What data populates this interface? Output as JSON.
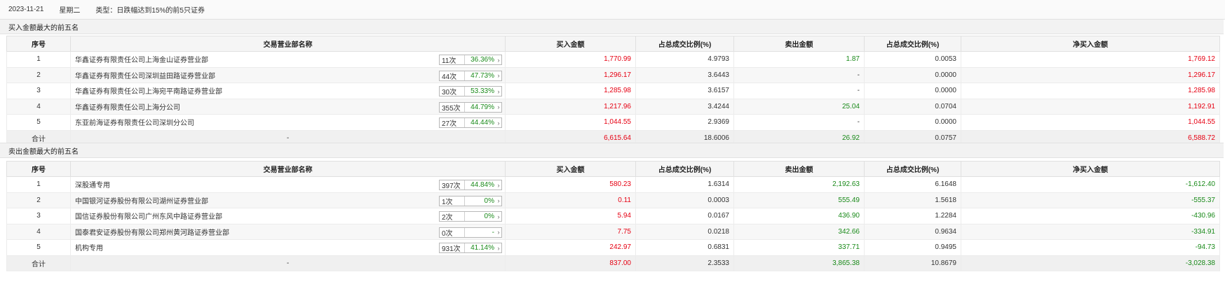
{
  "header": {
    "date": "2023-11-21",
    "weekday": "星期二",
    "type_label": "类型：",
    "type_value": "日跌幅达到15%的前5只证券"
  },
  "columns": [
    "序号",
    "交易营业部名称",
    "买入金额",
    "占总成交比例(%)",
    "卖出金额",
    "占总成交比例(%)",
    "净买入金额"
  ],
  "buy_section": {
    "title": "买入金额最大的前五名",
    "rows": [
      {
        "idx": "1",
        "name": "华鑫证券有限责任公司上海金山证券营业部",
        "count": "11次",
        "rate": "36.36%",
        "buy": "1,770.99",
        "buy_pct": "4.9793",
        "sell": "1.87",
        "sell_pct": "0.0053",
        "net": "1,769.12"
      },
      {
        "idx": "2",
        "name": "华鑫证券有限责任公司深圳益田路证券营业部",
        "count": "44次",
        "rate": "47.73%",
        "buy": "1,296.17",
        "buy_pct": "3.6443",
        "sell": "-",
        "sell_pct": "0.0000",
        "net": "1,296.17"
      },
      {
        "idx": "3",
        "name": "华鑫证券有限责任公司上海宛平南路证券营业部",
        "count": "30次",
        "rate": "53.33%",
        "buy": "1,285.98",
        "buy_pct": "3.6157",
        "sell": "-",
        "sell_pct": "0.0000",
        "net": "1,285.98"
      },
      {
        "idx": "4",
        "name": "华鑫证券有限责任公司上海分公司",
        "count": "355次",
        "rate": "44.79%",
        "buy": "1,217.96",
        "buy_pct": "3.4244",
        "sell": "25.04",
        "sell_pct": "0.0704",
        "net": "1,192.91"
      },
      {
        "idx": "5",
        "name": "东亚前海证券有限责任公司深圳分公司",
        "count": "27次",
        "rate": "44.44%",
        "buy": "1,044.55",
        "buy_pct": "2.9369",
        "sell": "-",
        "sell_pct": "0.0000",
        "net": "1,044.55"
      }
    ],
    "total": {
      "label": "合计",
      "name": "-",
      "buy": "6,615.64",
      "buy_pct": "18.6006",
      "sell": "26.92",
      "sell_pct": "0.0757",
      "net": "6,588.72"
    }
  },
  "sell_section": {
    "title": "卖出金额最大的前五名",
    "rows": [
      {
        "idx": "1",
        "name": "深股通专用",
        "count": "397次",
        "rate": "44.84%",
        "buy": "580.23",
        "buy_pct": "1.6314",
        "sell": "2,192.63",
        "sell_pct": "6.1648",
        "net": "-1,612.40"
      },
      {
        "idx": "2",
        "name": "中国银河证券股份有限公司湖州证券营业部",
        "count": "1次",
        "rate": "0%",
        "buy": "0.11",
        "buy_pct": "0.0003",
        "sell": "555.49",
        "sell_pct": "1.5618",
        "net": "-555.37"
      },
      {
        "idx": "3",
        "name": "国信证券股份有限公司广州东风中路证券营业部",
        "count": "2次",
        "rate": "0%",
        "buy": "5.94",
        "buy_pct": "0.0167",
        "sell": "436.90",
        "sell_pct": "1.2284",
        "net": "-430.96"
      },
      {
        "idx": "4",
        "name": "国泰君安证券股份有限公司郑州黄河路证券营业部",
        "count": "0次",
        "rate": "-",
        "buy": "7.75",
        "buy_pct": "0.0218",
        "sell": "342.66",
        "sell_pct": "0.9634",
        "net": "-334.91"
      },
      {
        "idx": "5",
        "name": "机构专用",
        "count": "931次",
        "rate": "41.14%",
        "buy": "242.97",
        "buy_pct": "0.6831",
        "sell": "337.71",
        "sell_pct": "0.9495",
        "net": "-94.73"
      }
    ],
    "total": {
      "label": "合计",
      "name": "-",
      "buy": "837.00",
      "buy_pct": "2.3533",
      "sell": "3,865.38",
      "sell_pct": "10.8679",
      "net": "-3,028.38"
    }
  }
}
